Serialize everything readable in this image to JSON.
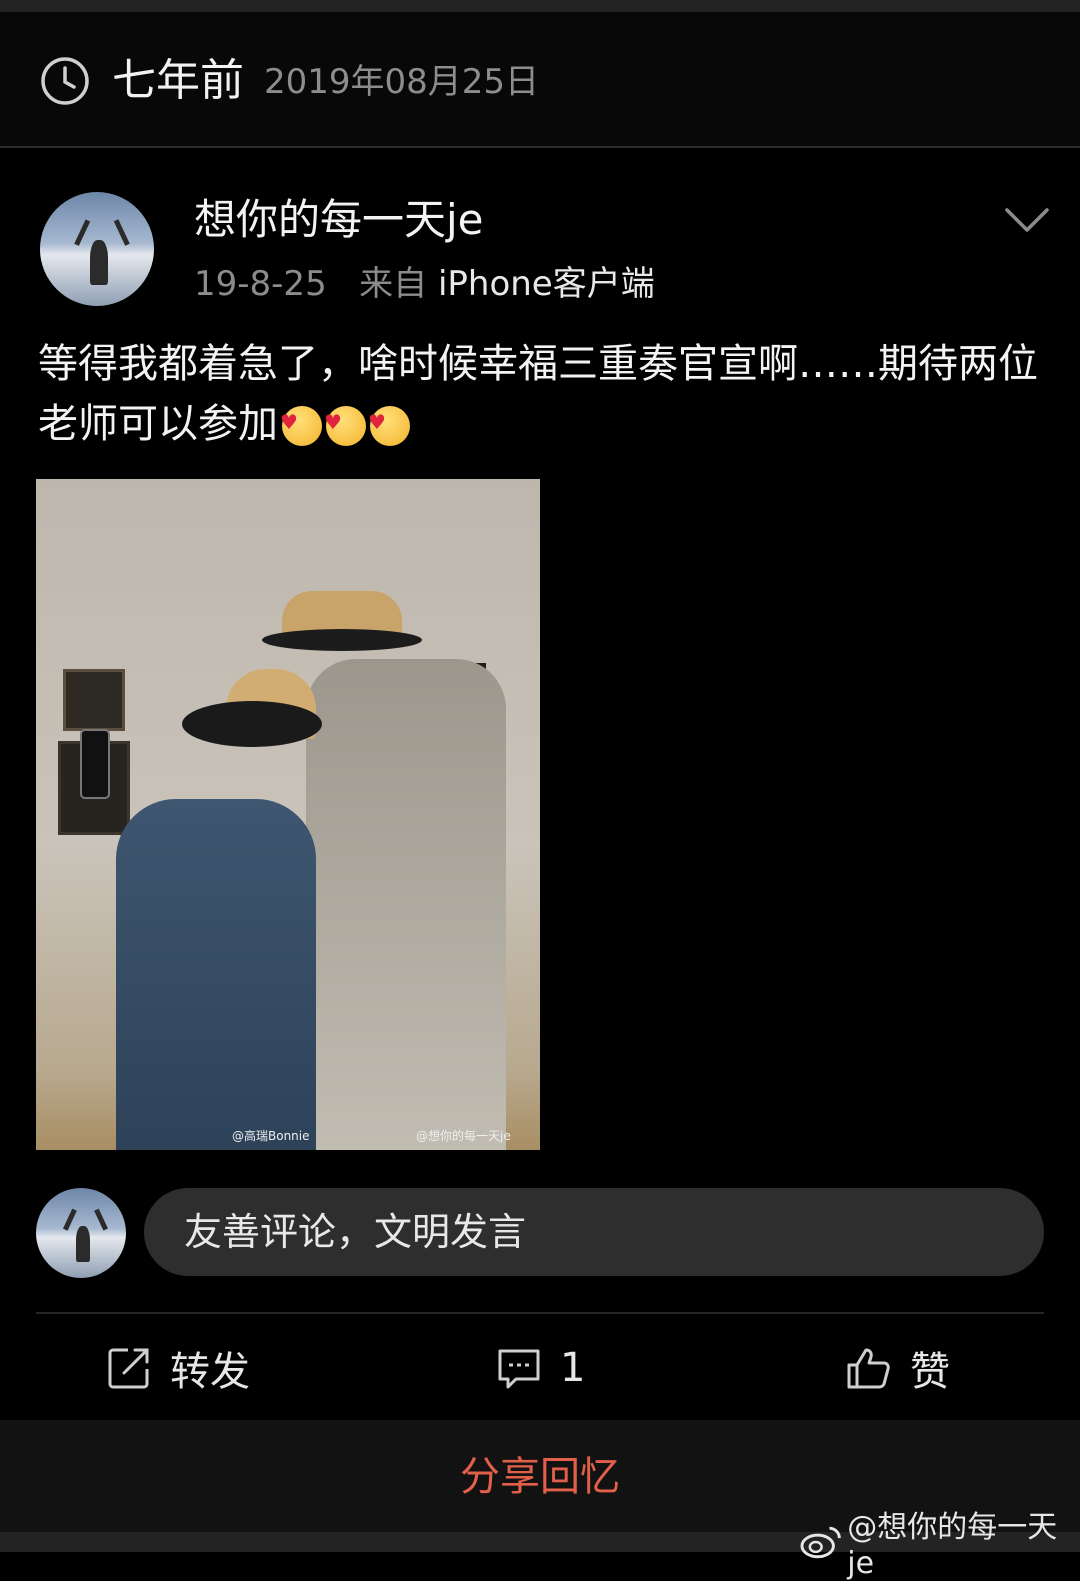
{
  "header": {
    "ago": "七年前",
    "date": "2019年08月25日"
  },
  "post": {
    "username": "想你的每一天je",
    "time": "19-8-25",
    "source_prefix": "来自",
    "source": "iPhone客户端",
    "text": "等得我都着急了，啥时候幸福三重奏官宣啊……期待两位老师可以参加",
    "emoji_count": 3,
    "image_watermarks": [
      "@高瑞Bonnie",
      "@想你的每一天je"
    ]
  },
  "comment": {
    "placeholder": "友善评论，文明发言"
  },
  "actions": {
    "repost_label": "转发",
    "comment_count": "1",
    "like_label": "赞"
  },
  "share": {
    "label": "分享回忆"
  },
  "watermark": {
    "text": "@想你的每一天je"
  },
  "colors": {
    "background": "#000000",
    "accent": "#e2604a",
    "muted": "#8c8c8c"
  },
  "icons": [
    "clock-icon",
    "chevron-down-icon",
    "repost-icon",
    "comment-icon",
    "like-icon",
    "weibo-logo-icon"
  ]
}
